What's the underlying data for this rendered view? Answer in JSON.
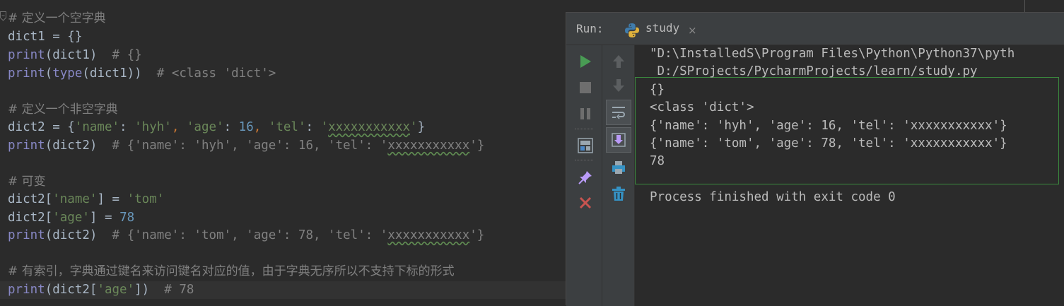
{
  "editor": {
    "lines": [
      {
        "segments": [
          {
            "c": "cmz",
            "t": "# 定义一个空字典"
          }
        ]
      },
      {
        "segments": [
          {
            "c": "tx",
            "t": "dict1 = {}"
          }
        ]
      },
      {
        "segments": [
          {
            "c": "bi",
            "t": "print"
          },
          {
            "c": "tx",
            "t": "(dict1)  "
          },
          {
            "c": "cm",
            "t": "# {}"
          }
        ]
      },
      {
        "segments": [
          {
            "c": "bi",
            "t": "print"
          },
          {
            "c": "tx",
            "t": "("
          },
          {
            "c": "bi",
            "t": "type"
          },
          {
            "c": "tx",
            "t": "(dict1))  "
          },
          {
            "c": "cm",
            "t": "# <class 'dict'>"
          }
        ]
      },
      {
        "segments": []
      },
      {
        "segments": [
          {
            "c": "cmz",
            "t": "# 定义一个非空字典"
          }
        ]
      },
      {
        "segments": [
          {
            "c": "tx",
            "t": "dict2 = {"
          },
          {
            "c": "st",
            "t": "'name'"
          },
          {
            "c": "tx",
            "t": ": "
          },
          {
            "c": "st",
            "t": "'hyh'"
          },
          {
            "c": "op",
            "t": ", "
          },
          {
            "c": "st",
            "t": "'age'"
          },
          {
            "c": "tx",
            "t": ": "
          },
          {
            "c": "nu",
            "t": "16"
          },
          {
            "c": "op",
            "t": ", "
          },
          {
            "c": "st",
            "t": "'tel'"
          },
          {
            "c": "tx",
            "t": ": "
          },
          {
            "c": "st",
            "t": "'"
          },
          {
            "c": "st sq",
            "t": "xxxxxxxxxxx"
          },
          {
            "c": "st",
            "t": "'"
          },
          {
            "c": "tx",
            "t": "}"
          }
        ]
      },
      {
        "segments": [
          {
            "c": "bi",
            "t": "print"
          },
          {
            "c": "tx",
            "t": "(dict2)  "
          },
          {
            "c": "cm",
            "t": "# {'name': 'hyh', 'age': 16, 'tel': '"
          },
          {
            "c": "cm sq",
            "t": "xxxxxxxxxxx"
          },
          {
            "c": "cm",
            "t": "'}"
          }
        ]
      },
      {
        "segments": []
      },
      {
        "segments": [
          {
            "c": "cmz",
            "t": "# 可变"
          }
        ]
      },
      {
        "segments": [
          {
            "c": "tx",
            "t": "dict2["
          },
          {
            "c": "st",
            "t": "'name'"
          },
          {
            "c": "tx",
            "t": "] = "
          },
          {
            "c": "st",
            "t": "'tom'"
          }
        ]
      },
      {
        "segments": [
          {
            "c": "tx",
            "t": "dict2["
          },
          {
            "c": "st",
            "t": "'age'"
          },
          {
            "c": "tx",
            "t": "] = "
          },
          {
            "c": "nu",
            "t": "78"
          }
        ]
      },
      {
        "segments": [
          {
            "c": "bi",
            "t": "print"
          },
          {
            "c": "tx",
            "t": "(dict2)  "
          },
          {
            "c": "cm",
            "t": "# {'name': 'tom', 'age': 78, 'tel': '"
          },
          {
            "c": "cm sq",
            "t": "xxxxxxxxxxx"
          },
          {
            "c": "cm",
            "t": "'}"
          }
        ]
      },
      {
        "segments": []
      },
      {
        "segments": [
          {
            "c": "cmz",
            "t": "# 有索引，字典通过键名来访问键名对应的值，由于字典无序所以不支持下标的形式"
          }
        ]
      },
      {
        "segments": [
          {
            "c": "bi",
            "t": "print"
          },
          {
            "c": "tx",
            "t": "(dict2["
          },
          {
            "c": "st",
            "t": "'age'"
          },
          {
            "c": "tx",
            "t": "])  "
          },
          {
            "c": "cm",
            "t": "# 78"
          }
        ]
      }
    ]
  },
  "run_panel": {
    "label": "Run:",
    "tab_label": "study",
    "tab_close": "×",
    "toolbar_left": [
      "run-icon",
      "stop-icon",
      "pause-icon",
      "layout-icon",
      "pin-icon",
      "close-icon"
    ],
    "toolbar_right": [
      "up-arrow-icon",
      "down-arrow-icon",
      "soft-wrap-icon",
      "scroll-to-end-icon",
      "print-icon",
      "trash-icon"
    ],
    "output": [
      "\"D:\\InstalledS\\Program Files\\Python\\Python37\\pyth",
      " D:/SProjects/PycharmProjects/learn/study.py",
      "{}",
      "<class 'dict'>",
      "{'name': 'hyh', 'age': 16, 'tel': 'xxxxxxxxxxx'}",
      "{'name': 'tom', 'age': 78, 'tel': 'xxxxxxxxxxx'}",
      "78",
      "",
      "Process finished with exit code 0"
    ]
  },
  "colors": {
    "background": "#2b2b2b",
    "panel": "#3c3f41",
    "comment": "#808080",
    "string": "#6a8759",
    "number": "#6897bb",
    "builtin": "#8888c6",
    "keyword": "#cc7832",
    "text": "#a9b7c6",
    "run_green": "#499c54",
    "stop_red": "#c75450",
    "highlight_border": "#3b8a3e"
  }
}
